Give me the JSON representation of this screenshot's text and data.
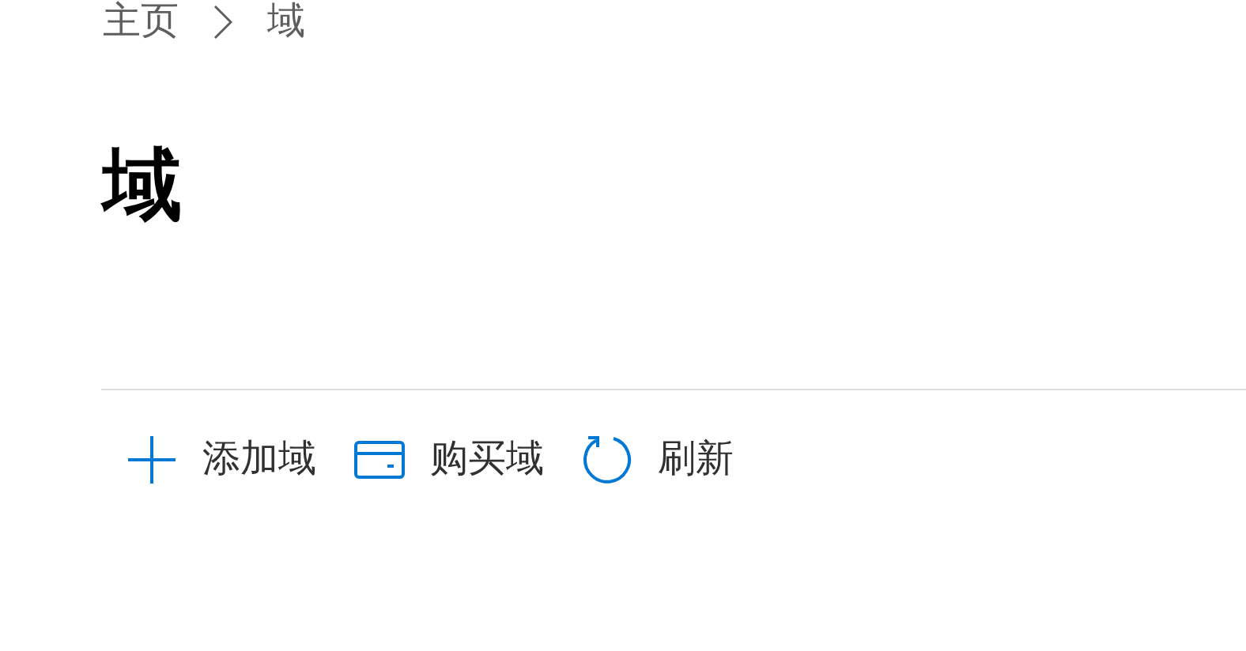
{
  "breadcrumb": [
    {
      "label": "主页"
    },
    {
      "label": "域"
    }
  ],
  "title": "域",
  "toolbar": [
    {
      "kind": "add",
      "label": "添加域"
    },
    {
      "kind": "card",
      "label": "购买域"
    },
    {
      "kind": "refresh",
      "label": "刷新"
    }
  ]
}
